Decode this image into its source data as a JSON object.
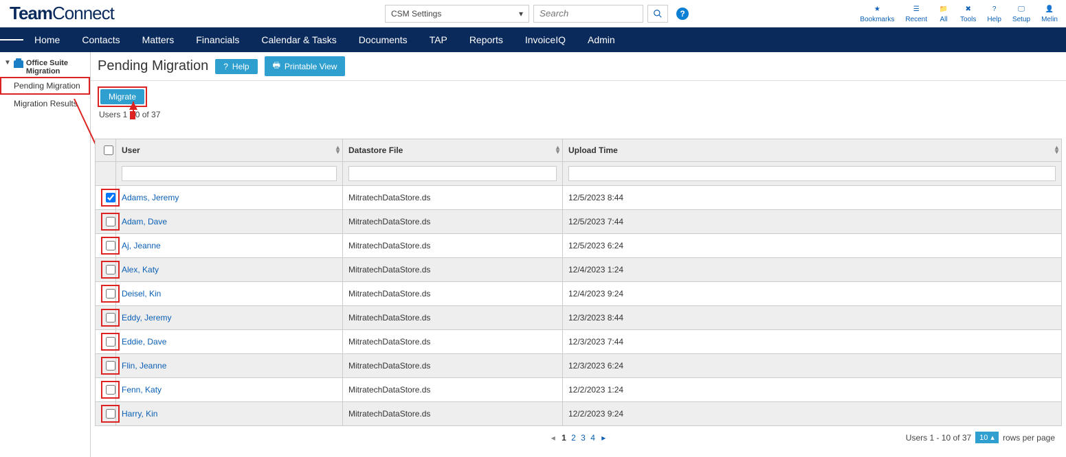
{
  "logo": {
    "bold": "Team",
    "light": "Connect"
  },
  "top": {
    "settings_label": "CSM Settings",
    "search_placeholder": "Search"
  },
  "top_links": [
    {
      "key": "bookmarks",
      "label": "Bookmarks"
    },
    {
      "key": "recent",
      "label": "Recent"
    },
    {
      "key": "all",
      "label": "All"
    },
    {
      "key": "tools",
      "label": "Tools"
    },
    {
      "key": "help",
      "label": "Help"
    },
    {
      "key": "setup",
      "label": "Setup"
    },
    {
      "key": "user",
      "label": "Melin"
    }
  ],
  "nav": [
    "Home",
    "Contacts",
    "Matters",
    "Financials",
    "Calendar & Tasks",
    "Documents",
    "TAP",
    "Reports",
    "InvoiceIQ",
    "Admin"
  ],
  "sidebar": {
    "header": "Office Suite Migration",
    "items": [
      "Pending Migration",
      "Migration Results"
    ],
    "active_index": 0
  },
  "page": {
    "title": "Pending Migration",
    "help_label": "Help",
    "print_label": "Printable View",
    "migrate_label": "Migrate"
  },
  "users_count": {
    "prefix": "Users 1",
    "mid": "0",
    "suffix": " of 37"
  },
  "table": {
    "headers": [
      "User",
      "Datastore File",
      "Upload Time"
    ],
    "rows": [
      {
        "checked": true,
        "user": "Adams, Jeremy",
        "file": "MitratechDataStore.ds",
        "time": "12/5/2023 8:44"
      },
      {
        "checked": false,
        "user": "Adam, Dave",
        "file": "MitratechDataStore.ds",
        "time": "12/5/2023 7:44"
      },
      {
        "checked": false,
        "user": "Aj, Jeanne",
        "file": "MitratechDataStore.ds",
        "time": "12/5/2023 6:24"
      },
      {
        "checked": false,
        "user": "Alex, Katy",
        "file": "MitratechDataStore.ds",
        "time": "12/4/2023 1:24"
      },
      {
        "checked": false,
        "user": "Deisel, Kin",
        "file": "MitratechDataStore.ds",
        "time": "12/4/2023 9:24"
      },
      {
        "checked": false,
        "user": "Eddy, Jeremy",
        "file": "MitratechDataStore.ds",
        "time": "12/3/2023 8:44"
      },
      {
        "checked": false,
        "user": "Eddie, Dave",
        "file": "MitratechDataStore.ds",
        "time": "12/3/2023 7:44"
      },
      {
        "checked": false,
        "user": "Flin, Jeanne",
        "file": "MitratechDataStore.ds",
        "time": "12/3/2023 6:24"
      },
      {
        "checked": false,
        "user": "Fenn, Katy",
        "file": "MitratechDataStore.ds",
        "time": "12/2/2023 1:24"
      },
      {
        "checked": false,
        "user": "Harry, Kin",
        "file": "MitratechDataStore.ds",
        "time": "12/2/2023 9:24"
      }
    ]
  },
  "pagination": {
    "pages": [
      "1",
      "2",
      "3",
      "4"
    ],
    "current": "1",
    "summary": "Users  1 - 10 of 37",
    "rows_per_page": "10",
    "rows_label": "rows per page"
  }
}
